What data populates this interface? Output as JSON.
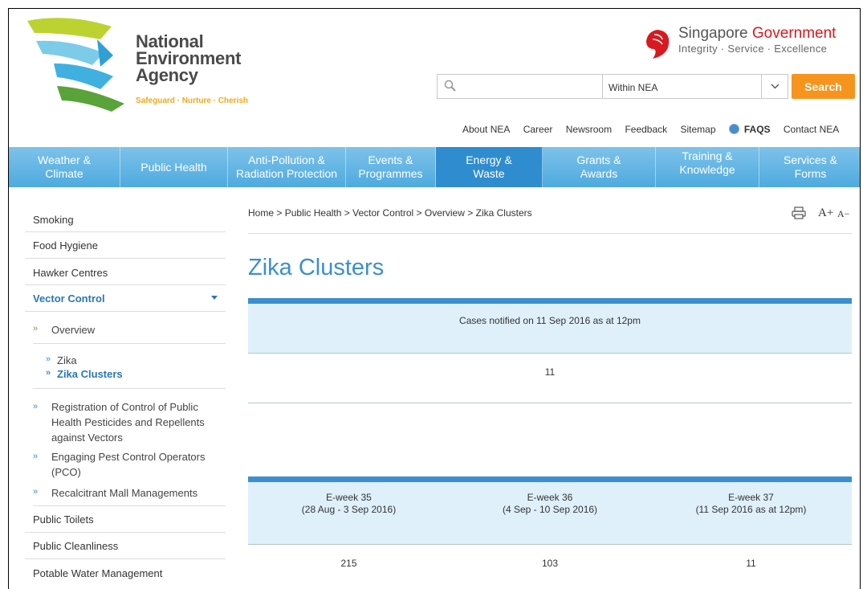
{
  "header": {
    "logo": {
      "line1": "National",
      "line2": "Environment",
      "line3": "Agency",
      "tagline": "Safeguard · Nurture · Cherish"
    },
    "sg": {
      "title_part1": "Singapore",
      "title_part2": "Government",
      "subtitle": "Integrity · Service · Excellence"
    },
    "search": {
      "placeholder": "",
      "scope_selected": "Within NEA",
      "button_label": "Search"
    },
    "utility_links": [
      "About NEA",
      "Career",
      "Newsroom",
      "Feedback",
      "Sitemap",
      "FAQS",
      "Contact NEA"
    ]
  },
  "nav": [
    {
      "line1": "Weather &",
      "line2": "Climate"
    },
    {
      "line1": "Public Health",
      "line2": ""
    },
    {
      "line1": "Anti-Pollution &",
      "line2": "Radiation Protection"
    },
    {
      "line1": "Events &",
      "line2": "Programmes"
    },
    {
      "line1": "Energy &",
      "line2": "Waste"
    },
    {
      "line1": "Grants &",
      "line2": "Awards"
    },
    {
      "line1": "Training &",
      "line2": "Knowledge"
    },
    {
      "line1": "Services &",
      "line2": "Forms"
    }
  ],
  "sidebar": {
    "items_top": [
      "Smoking",
      "Food Hygiene",
      "Hawker Centres"
    ],
    "vector_control": "Vector Control",
    "overview": "Overview",
    "overview_children": [
      "Zika",
      "Zika Clusters"
    ],
    "vc_children": [
      {
        "line1": "Registration of Control of Public",
        "line2": "Health Pesticides and Repellents",
        "line3": "against Vectors"
      },
      {
        "line1": "Engaging Pest Control Operators",
        "line2": "(PCO)"
      },
      {
        "line1": "Recalcitrant Mall Managements"
      }
    ],
    "items_bottom": [
      "Public Toilets",
      "Public Cleanliness",
      "Potable Water Management"
    ]
  },
  "content": {
    "breadcrumb": [
      "Home",
      "Public Health",
      "Vector Control",
      "Overview",
      "Zika Clusters"
    ],
    "breadcrumb_sep": ">",
    "font_up": "A+",
    "font_down": "A−",
    "title": "Zika Clusters",
    "table1": {
      "header": "Cases notified on 11 Sep 2016 as at 12pm",
      "value": "11"
    },
    "table2": {
      "columns": [
        {
          "week": "E-week 35",
          "range": "(28 Aug - 3 Sep 2016)",
          "value": "215"
        },
        {
          "week": "E-week 36",
          "range": "(4 Sep - 10 Sep 2016)",
          "value": "103"
        },
        {
          "week": "E-week 37",
          "range": "(11 Sep 2016 as at 12pm)",
          "value": "11"
        }
      ]
    }
  },
  "colors": {
    "nav_bg": "#5bb3e4",
    "nav_active": "#2f8dcf",
    "accent": "#3b8fcf",
    "search_button": "#f7941d",
    "table_header": "#dff0fb"
  }
}
